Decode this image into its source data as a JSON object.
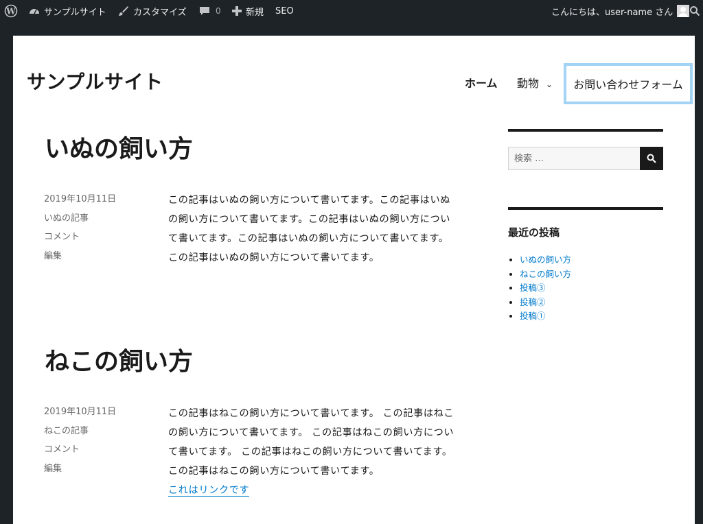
{
  "adminbar": {
    "site_name": "サンプルサイト",
    "customize": "カスタマイズ",
    "comments_count": "0",
    "new": "新規",
    "seo": "SEO",
    "greeting": "こんにちは、user-name さん"
  },
  "site": {
    "title": "サンプルサイト"
  },
  "nav": {
    "home": "ホーム",
    "animals": "動物",
    "contact": "お問い合わせフォーム"
  },
  "posts": [
    {
      "title": "いぬの飼い方",
      "date": "2019年10月11日",
      "category": "いぬの記事",
      "comment": "コメント",
      "edit": "編集",
      "lines": [
        "この記事はいぬの飼い方について書いてます。この記事はいぬ",
        "の飼い方について書いてます。この記事はいぬの飼い方につい",
        "て書いてます。この記事はいぬの飼い方について書いてます。",
        "この記事はいぬの飼い方について書いてます。"
      ]
    },
    {
      "title": "ねこの飼い方",
      "date": "2019年10月11日",
      "category": "ねこの記事",
      "comment": "コメント",
      "edit": "編集",
      "lines": [
        "この記事はねこの飼い方について書いてます。 この記事はねこ",
        "の飼い方について書いてます。 この記事はねこの飼い方につい",
        "て書いてます。 この記事はねこの飼い方について書いてます。",
        "この記事はねこの飼い方について書いてます。"
      ],
      "link": "これはリンクです"
    }
  ],
  "sidebar": {
    "search_placeholder": "検索 …",
    "recent_title": "最近の投稿",
    "recent_posts": [
      "いぬの飼い方",
      "ねこの飼い方",
      "投稿③",
      "投稿②",
      "投稿①"
    ]
  }
}
